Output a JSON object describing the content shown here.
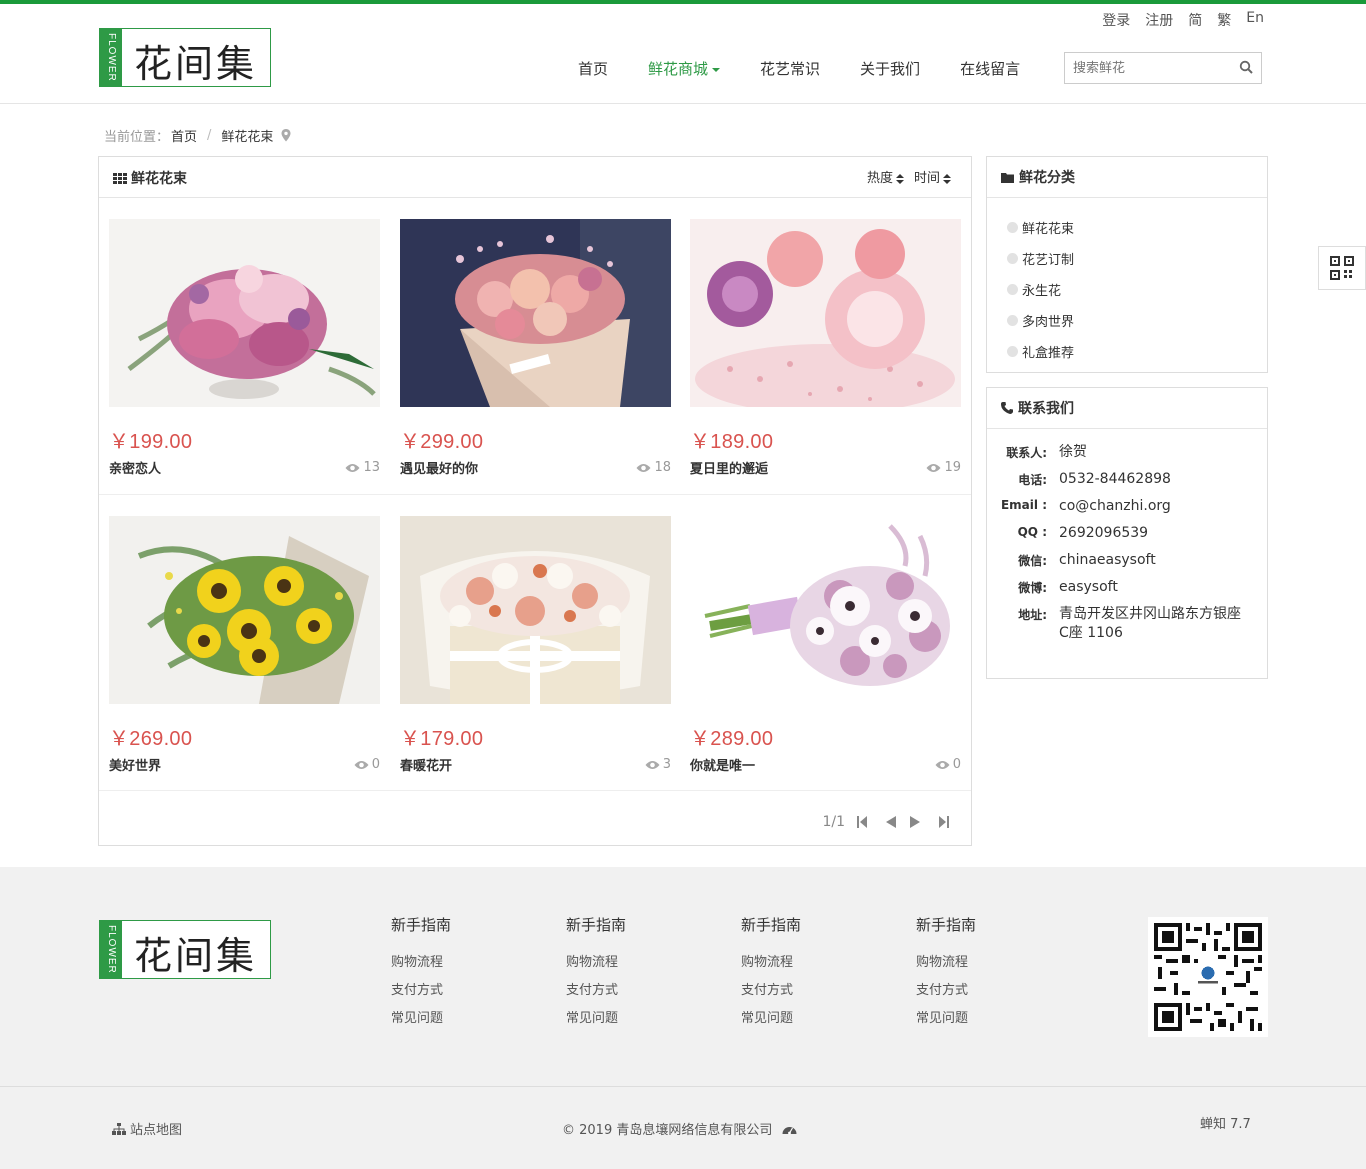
{
  "header": {
    "logo_side": "FLOWER",
    "logo_name": "花间集",
    "top_links": [
      "登录",
      "注册",
      "简",
      "繁",
      "En"
    ],
    "nav": [
      {
        "label": "首页",
        "active": false,
        "dropdown": false
      },
      {
        "label": "鲜花商城",
        "active": true,
        "dropdown": true
      },
      {
        "label": "花艺常识",
        "active": false,
        "dropdown": false
      },
      {
        "label": "关于我们",
        "active": false,
        "dropdown": false
      },
      {
        "label": "在线留言",
        "active": false,
        "dropdown": false
      }
    ],
    "search_placeholder": "搜索鲜花",
    "accent_color": "#2e9a46"
  },
  "breadcrumb": {
    "prefix": "当前位置：",
    "items": [
      "首页",
      "鲜花花束"
    ],
    "separator": "/"
  },
  "main": {
    "title": "鲜花花束",
    "sorts": [
      "热度",
      "时间"
    ],
    "products": [
      {
        "price": "￥199.00",
        "title": "亲密恋人",
        "views": "13"
      },
      {
        "price": "￥299.00",
        "title": "遇见最好的你",
        "views": "18"
      },
      {
        "price": "￥189.00",
        "title": "夏日里的邂逅",
        "views": "19"
      },
      {
        "price": "￥269.00",
        "title": "美好世界",
        "views": "0"
      },
      {
        "price": "￥179.00",
        "title": "春暖花开",
        "views": "3"
      },
      {
        "price": "￥289.00",
        "title": "你就是唯一",
        "views": "0"
      }
    ],
    "pager": {
      "text": "1/1"
    },
    "price_color": "#d9534f"
  },
  "sidebar": {
    "categories_title": "鲜花分类",
    "categories": [
      "鲜花花束",
      "花艺订制",
      "永生花",
      "多肉世界",
      "礼盒推荐"
    ],
    "contact_title": "联系我们",
    "contact": [
      {
        "label": "联系人:",
        "value": "徐贺"
      },
      {
        "label": "电话:",
        "value": "0532-84462898"
      },
      {
        "label": "Email :",
        "value": "co@chanzhi.org"
      },
      {
        "label": "QQ :",
        "value": "2692096539"
      },
      {
        "label": "微信:",
        "value": "chinaeasysoft"
      },
      {
        "label": "微博:",
        "value": "easysoft"
      },
      {
        "label": "地址:",
        "value": "青岛开发区井冈山路东方银座C座 1106"
      }
    ]
  },
  "footer": {
    "columns": [
      {
        "title": "新手指南",
        "links": [
          "购物流程",
          "支付方式",
          "常见问题"
        ]
      },
      {
        "title": "新手指南",
        "links": [
          "购物流程",
          "支付方式",
          "常见问题"
        ]
      },
      {
        "title": "新手指南",
        "links": [
          "购物流程",
          "支付方式",
          "常见问题"
        ]
      },
      {
        "title": "新手指南",
        "links": [
          "购物流程",
          "支付方式",
          "常见问题"
        ]
      }
    ],
    "sitemap": "站点地图",
    "copyright": "© 2019 青岛息壤网络信息有限公司",
    "version": "蝉知 7.7"
  }
}
